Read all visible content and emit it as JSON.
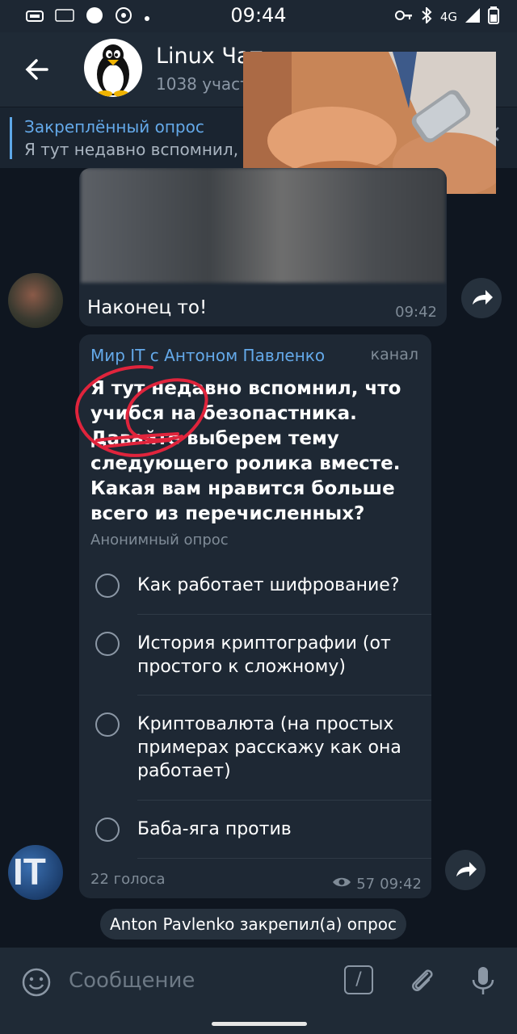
{
  "status_bar": {
    "time": "09:44",
    "network": "4G"
  },
  "chat": {
    "title": "Linux Чат",
    "subtitle": "1038 участников"
  },
  "pinned": {
    "title": "Закреплённый опрос",
    "text": "Я тут недавно вспомнил, что учибся на безопастника."
  },
  "messages": [
    {
      "text": "Наконец то!",
      "time": "09:42"
    }
  ],
  "poll": {
    "author": "Мир IT с Антоном Павленко",
    "channel_badge": "канал",
    "question": "Я тут недавно вспомнил, что учибся на безопастника. Давайте выберем тему следующего ролика вместе. Какая вам нравится больше всего из перечисленных?",
    "type": "Анонимный опрос",
    "options": [
      {
        "label": "Как работает шифрование?"
      },
      {
        "label": "История криптографии  (от простого к сложному)"
      },
      {
        "label": "Криптовалюта (на простых примерах расскажу как она работает)"
      },
      {
        "label": "Баба-яга против"
      }
    ],
    "votes": "22 голоса",
    "views": "57",
    "time": "09:42"
  },
  "service_message": "Anton Pavlenko закрепил(а) опрос",
  "input": {
    "placeholder": "Сообщение"
  },
  "avatar_it_text": "IT",
  "icons": [
    "back-arrow-icon",
    "close-icon",
    "forward-icon",
    "eye-icon",
    "emoji-icon",
    "bot-command-icon",
    "attach-icon",
    "mic-icon"
  ],
  "colors": {
    "accent": "#64a9e9",
    "background": "#0f1620",
    "bubble": "#1e2834",
    "annotation": "#e0243c"
  }
}
